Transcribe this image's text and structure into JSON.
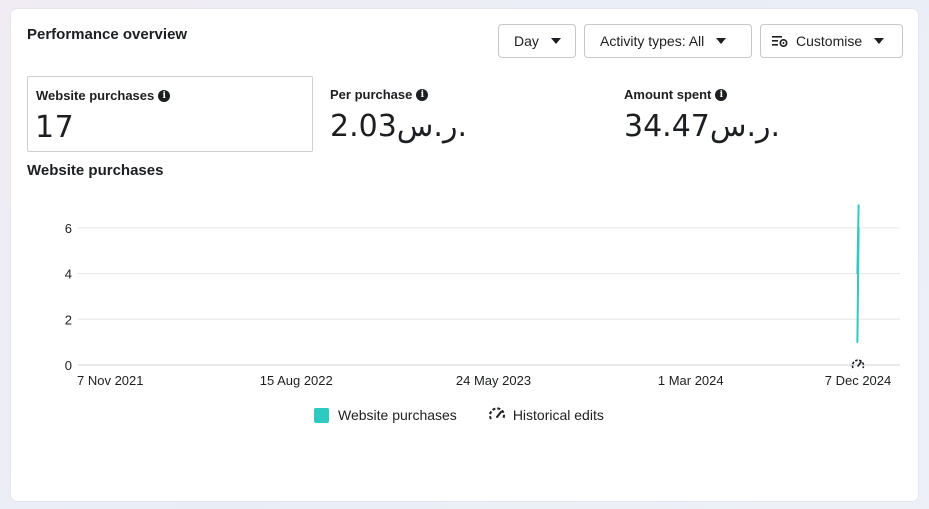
{
  "header": {
    "title": "Performance overview",
    "buttons": {
      "day": "Day",
      "activity": "Activity types: All",
      "customise": "Customise"
    }
  },
  "metrics": [
    {
      "label": "Website purchases",
      "value": "17"
    },
    {
      "label": "Per purchase",
      "value": "2.03ر.س."
    },
    {
      "label": "Amount spent",
      "value": "34.47ر.س."
    }
  ],
  "chart_data": {
    "type": "line",
    "title": "Website purchases",
    "x_tick_labels": [
      "7 Nov 2021",
      "15 Aug 2022",
      "24 May 2023",
      "1 Mar 2024",
      "7 Dec 2024"
    ],
    "y_tick_labels": [
      "0",
      "2",
      "4",
      "6"
    ],
    "ylim": [
      0,
      7
    ],
    "grid": true,
    "series": [
      {
        "name": "Website purchases",
        "color": "#2ec9c0",
        "points": [
          {
            "x": "7 Dec 2024",
            "y": 7
          },
          {
            "x": "7 Dec 2024",
            "y": 4
          },
          {
            "x": "7 Dec 2024",
            "y": 6
          },
          {
            "x": "7 Dec 2024",
            "y": 1
          }
        ]
      }
    ],
    "legend": [
      {
        "label": "Website purchases",
        "icon": "teal-square"
      },
      {
        "label": "Historical edits",
        "icon": "historical-edits-icon"
      }
    ],
    "legend_placement": "bottom"
  }
}
